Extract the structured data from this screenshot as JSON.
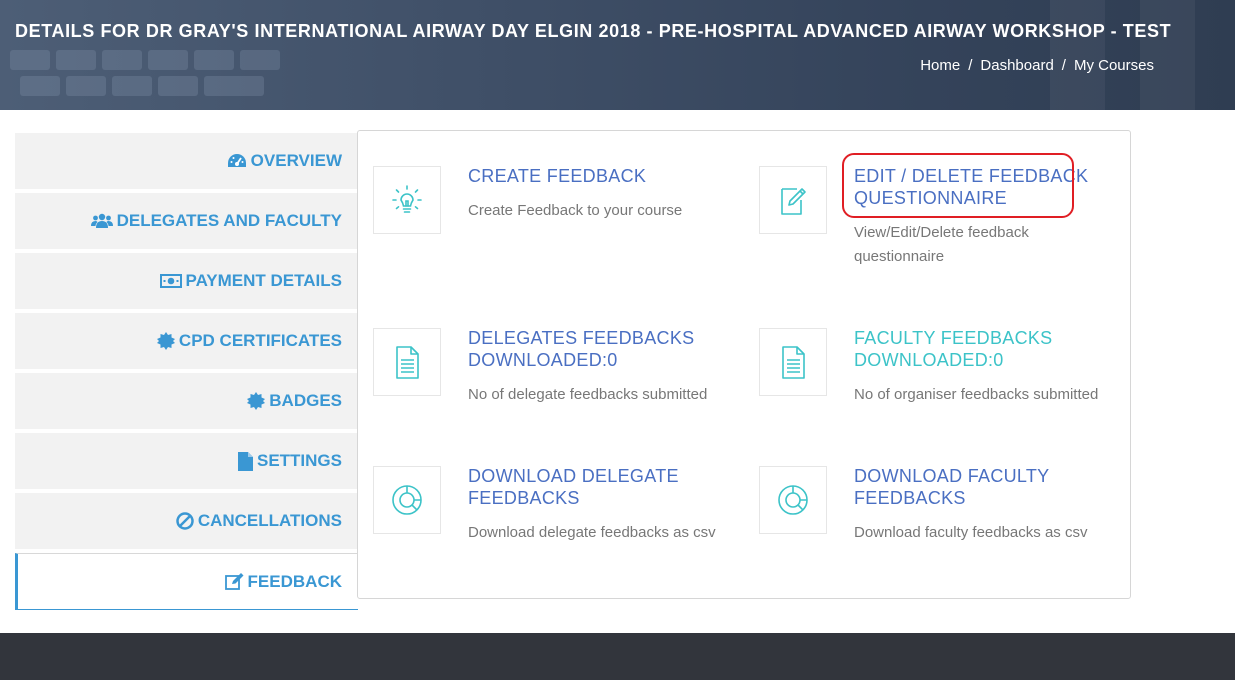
{
  "header": {
    "title": "DETAILS FOR DR GRAY'S INTERNATIONAL AIRWAY DAY ELGIN 2018 - PRE-HOSPITAL ADVANCED AIRWAY WORKSHOP - TEST",
    "breadcrumb": {
      "home": "Home",
      "dashboard": "Dashboard",
      "my_courses": "My Courses",
      "separator": "/"
    }
  },
  "sidebar": {
    "items": [
      {
        "label": "OVERVIEW",
        "icon": "dashboard-icon"
      },
      {
        "label": "DELEGATES AND FACULTY",
        "icon": "users-icon"
      },
      {
        "label": "PAYMENT DETAILS",
        "icon": "money-icon"
      },
      {
        "label": "CPD CERTIFICATES",
        "icon": "certificate-icon"
      },
      {
        "label": "BADGES",
        "icon": "certificate-icon"
      },
      {
        "label": "SETTINGS",
        "icon": "file-icon"
      },
      {
        "label": "CANCELLATIONS",
        "icon": "ban-icon"
      },
      {
        "label": "FEEDBACK",
        "icon": "edit-icon",
        "active": true
      }
    ]
  },
  "cards": {
    "create": {
      "title": "CREATE FEEDBACK",
      "desc": "Create Feedback to your course",
      "icon": "lightbulb-icon"
    },
    "edit": {
      "title": "EDIT / DELETE FEEDBACK QUESTIONNAIRE",
      "desc": "View/Edit/Delete feedback questionnaire",
      "icon": "edit-document-icon"
    },
    "delegates": {
      "title": "DELEGATES FEEDBACKS DOWNLOADED:0",
      "desc": "No of delegate feedbacks submitted",
      "icon": "document-lines-icon"
    },
    "faculty": {
      "title": "FACULTY FEEDBACKS DOWNLOADED:0",
      "desc": "No of organiser feedbacks submitted",
      "icon": "document-lines-icon"
    },
    "download_delegate": {
      "title": "DOWNLOAD DELEGATE FEEDBACKS",
      "desc": "Download delegate feedbacks as csv",
      "icon": "pie-chart-icon"
    },
    "download_faculty": {
      "title": "DOWNLOAD FACULTY FEEDBACKS",
      "desc": "Download faculty feedbacks as csv",
      "icon": "pie-chart-icon"
    }
  },
  "colors": {
    "accent": "#3a97d3",
    "title_blue": "#4a6fc2",
    "teal": "#3cc3c8",
    "highlight": "#e01e24"
  }
}
